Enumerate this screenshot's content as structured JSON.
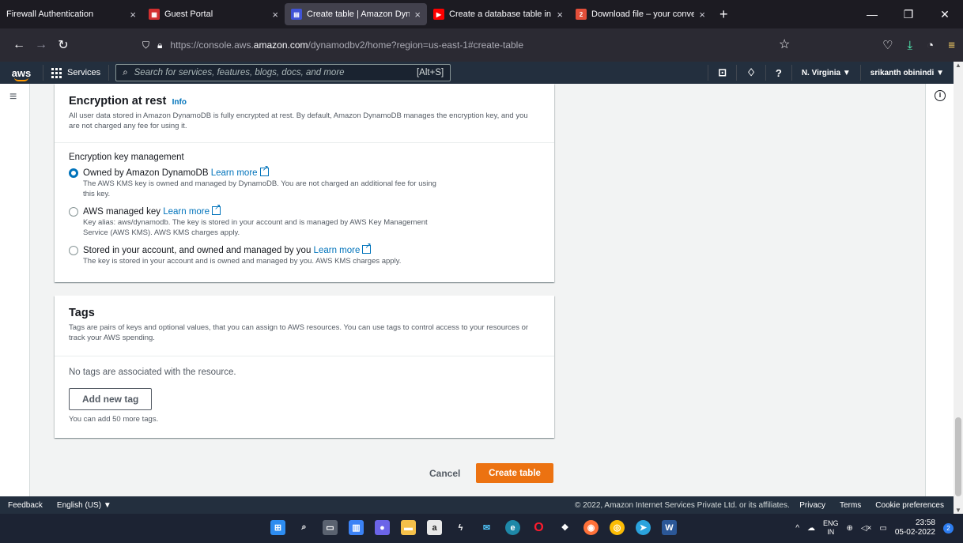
{
  "browser": {
    "tabs": [
      {
        "title": "Firewall Authentication",
        "icon": "none",
        "color": ""
      },
      {
        "title": "Guest Portal",
        "icon": "fortinet-icon",
        "color": "#d32f2f"
      },
      {
        "title": "Create table | Amazon Dynamo",
        "icon": "dynamodb-icon",
        "color": "#4053d6",
        "active": true
      },
      {
        "title": "Create a database table in clou",
        "icon": "youtube-icon",
        "color": "#ff0000"
      },
      {
        "title": "Download file – your conversio",
        "icon": "convertio-icon",
        "color": "#e34f3a"
      }
    ],
    "url_prefix": "https://console.aws.",
    "url_domain": "amazon.com",
    "url_suffix": "/dynamodbv2/home?region=us-east-1#create-table"
  },
  "aws_header": {
    "logo": "aws",
    "services": "Services",
    "search_placeholder": "Search for services, features, blogs, docs, and more",
    "search_shortcut": "[Alt+S]",
    "region": "N. Virginia ▼",
    "user": "srikanth obinindi ▼"
  },
  "encryption": {
    "title": "Encryption at rest",
    "info": "Info",
    "description": "All user data stored in Amazon DynamoDB is fully encrypted at rest. By default, Amazon DynamoDB manages the encryption key, and you are not charged any fee for using it.",
    "key_mgmt_label": "Encryption key management",
    "options": [
      {
        "label": "Owned by Amazon DynamoDB",
        "link": "Learn more",
        "desc": "The AWS KMS key is owned and managed by DynamoDB. You are not charged an additional fee for using this key.",
        "selected": true
      },
      {
        "label": "AWS managed key",
        "link": "Learn more",
        "desc": "Key alias: aws/dynamodb. The key is stored in your account and is managed by AWS Key Management Service (AWS KMS). AWS KMS charges apply.",
        "selected": false
      },
      {
        "label": "Stored in your account, and owned and managed by you",
        "link": "Learn more",
        "desc": "The key is stored in your account and is owned and managed by you. AWS KMS charges apply.",
        "selected": false
      }
    ]
  },
  "tags": {
    "title": "Tags",
    "description": "Tags are pairs of keys and optional values, that you can assign to AWS resources. You can use tags to control access to your resources or track your AWS spending.",
    "empty": "No tags are associated with the resource.",
    "add_button": "Add new tag",
    "note": "You can add 50 more tags."
  },
  "actions": {
    "cancel": "Cancel",
    "create": "Create table"
  },
  "footer": {
    "feedback": "Feedback",
    "language": "English (US) ▼",
    "copyright": "© 2022, Amazon Internet Services Private Ltd. or its affiliates.",
    "privacy": "Privacy",
    "terms": "Terms",
    "cookies": "Cookie preferences"
  },
  "taskbar": {
    "lang": "ENG",
    "lang_region": "IN",
    "time": "23:58",
    "date": "05-02-2022",
    "notifications": "2"
  }
}
